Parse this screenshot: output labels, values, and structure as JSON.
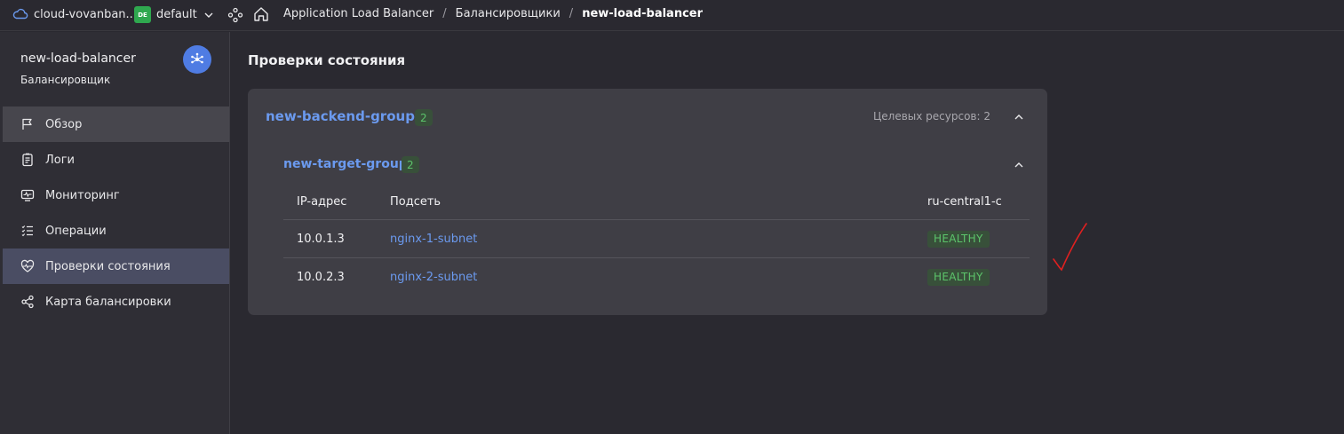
{
  "topbar": {
    "cloud_name": "cloud-vovanban...",
    "folder_badge": "DE",
    "folder_name": "default",
    "breadcrumbs": [
      "Application Load Balancer",
      "Балансировщики",
      "new-load-balancer"
    ]
  },
  "sidebar": {
    "title": "new-load-balancer",
    "subtitle": "Балансировщик",
    "items": [
      {
        "label": "Обзор",
        "icon": "flag-icon"
      },
      {
        "label": "Логи",
        "icon": "logs-icon"
      },
      {
        "label": "Мониторинг",
        "icon": "monitoring-icon"
      },
      {
        "label": "Операции",
        "icon": "operations-icon"
      },
      {
        "label": "Проверки состояния",
        "icon": "heart-pulse-icon"
      },
      {
        "label": "Карта балансировки",
        "icon": "map-nodes-icon"
      }
    ]
  },
  "main": {
    "title": "Проверки состояния",
    "backend_group": {
      "name": "new-backend-group",
      "count": "2",
      "targets_label": "Целевых ресурсов: 2"
    },
    "target_group": {
      "name": "new-target-group",
      "count": "2"
    },
    "table": {
      "headers": [
        "IP-адрес",
        "Подсеть",
        "ru-central1-c"
      ],
      "rows": [
        {
          "ip": "10.0.1.3",
          "subnet": "nginx-1-subnet",
          "status": "HEALTHY"
        },
        {
          "ip": "10.0.2.3",
          "subnet": "nginx-2-subnet",
          "status": "HEALTHY"
        }
      ]
    }
  },
  "colors": {
    "accent_link": "#6b9aef",
    "healthy": "#5cc46b",
    "annotation": "#e02020"
  }
}
